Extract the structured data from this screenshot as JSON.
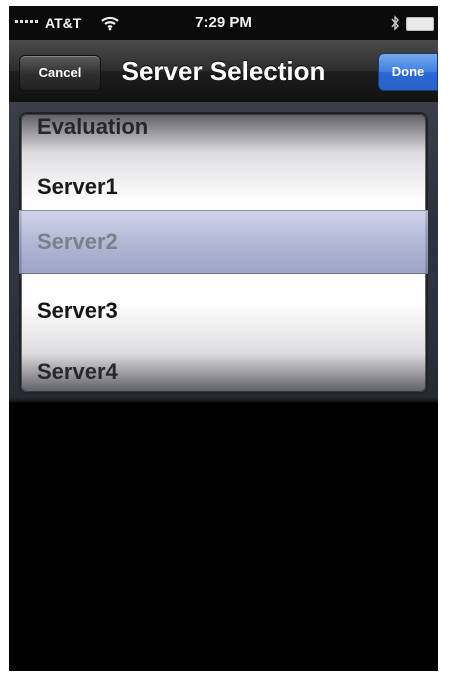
{
  "status_bar": {
    "carrier": "AT&T",
    "time": "7:29 PM",
    "icons": [
      "signal-icon",
      "wifi-icon",
      "bluetooth-icon",
      "battery-icon"
    ]
  },
  "nav_bar": {
    "title": "Server Selection",
    "cancel_label": "Cancel",
    "done_label": "Done",
    "done_color": "#3f7fe0"
  },
  "picker": {
    "items": [
      "Evaluation",
      "Server1",
      "Server2",
      "Server3",
      "Server4"
    ],
    "selected": "Server2"
  }
}
